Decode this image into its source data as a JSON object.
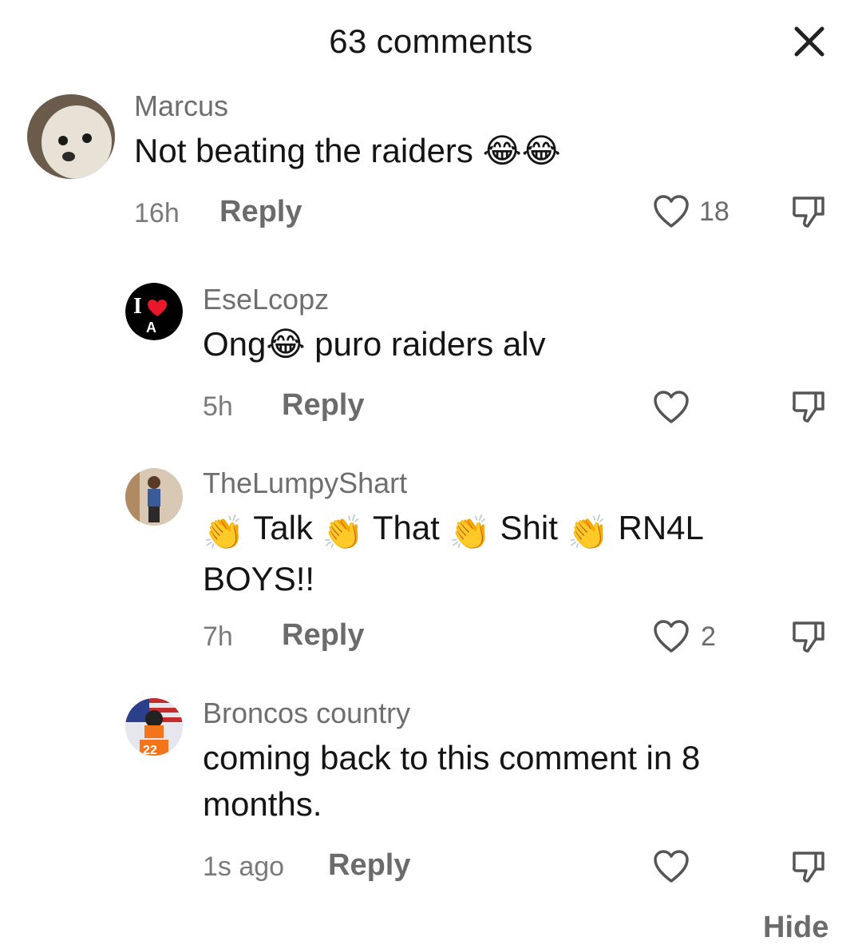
{
  "header": {
    "title": "63 comments",
    "close_icon": "close-icon"
  },
  "comments": [
    {
      "username": "Marcus",
      "text": "Not beating the raiders 😂😂",
      "time": "16h",
      "reply": "Reply",
      "likes": "18"
    },
    {
      "username": "EseLcopz",
      "text": "Ong😂 puro raiders alv",
      "time": "5h",
      "reply": "Reply",
      "likes": ""
    },
    {
      "username": "TheLumpyShart",
      "text_parts": [
        "Talk",
        "That",
        "Shit",
        "RN4L"
      ],
      "text_line2": "BOYS!!",
      "time": "7h",
      "reply": "Reply",
      "likes": "2"
    },
    {
      "username": "Broncos country",
      "text_line1": "coming back to this comment in 8",
      "text_line2": "months.",
      "time": "1s ago",
      "reply": "Reply",
      "likes": ""
    }
  ],
  "footer": {
    "hide": "Hide"
  },
  "colors": {
    "meta": "#6b6b6b",
    "text": "#141414",
    "background": "#ffffff"
  }
}
